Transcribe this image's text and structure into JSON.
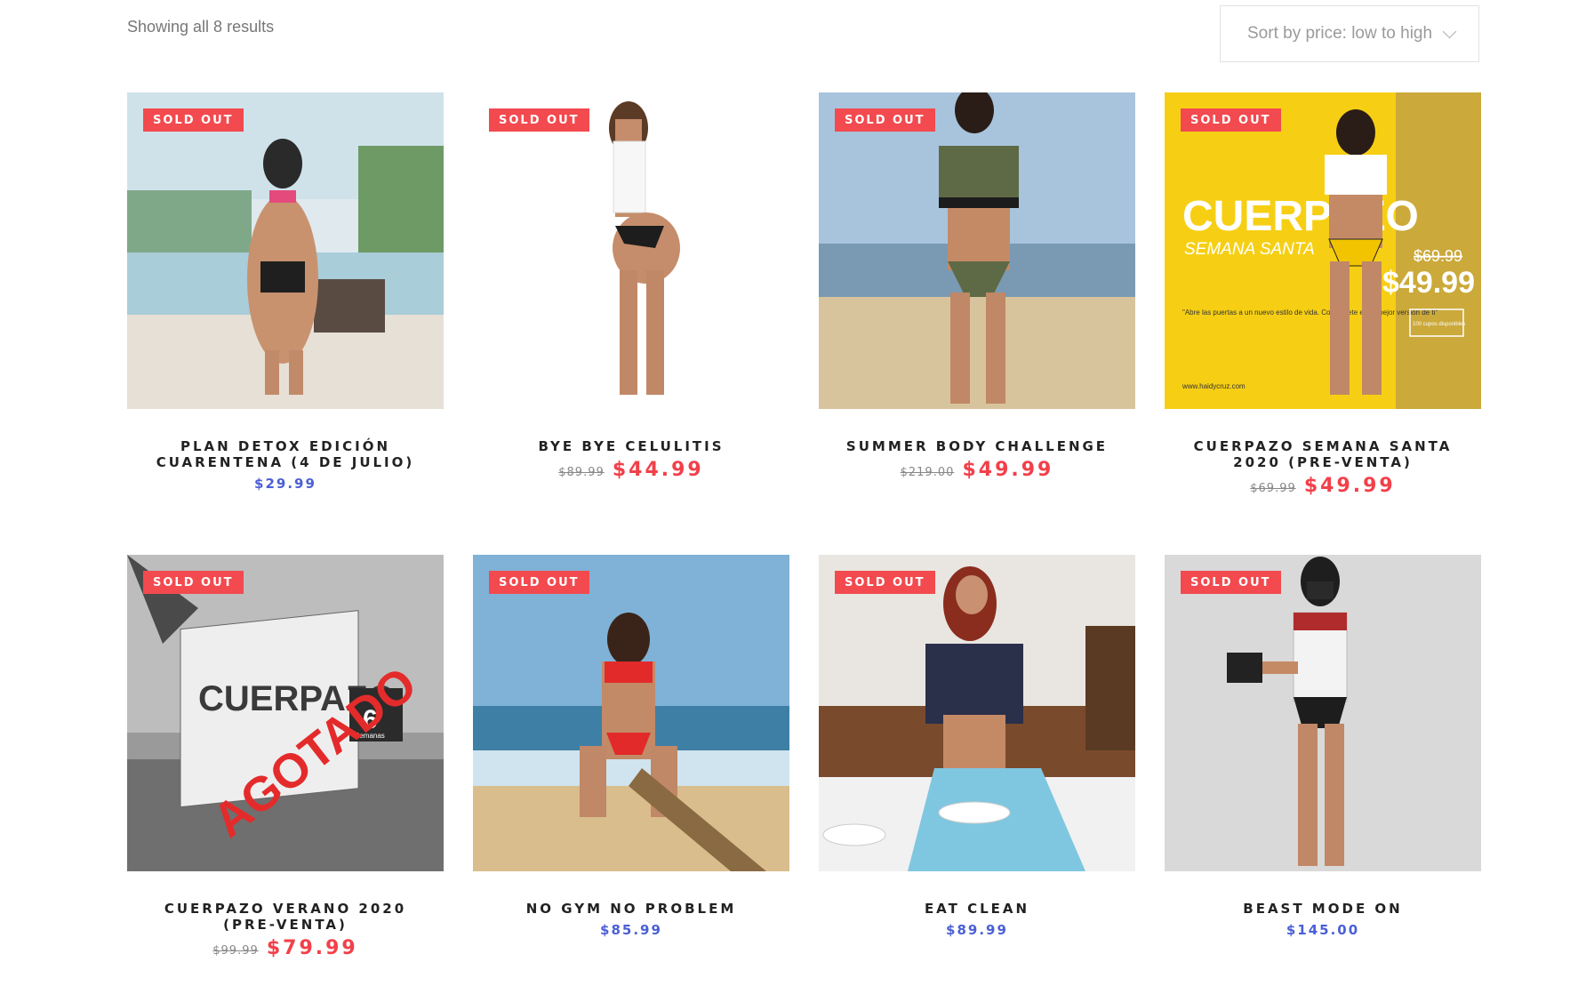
{
  "toolbar": {
    "result_count": "Showing all 8 results",
    "sort_label": "Sort by price: low to high"
  },
  "products": [
    {
      "title": "PLAN DETOX EDICIÓN CUARENTENA (4 DE JULIO)",
      "badge": "SOLD OUT",
      "price": "$29.99",
      "old_price": "",
      "sale_price": ""
    },
    {
      "title": "BYE BYE CELULITIS",
      "badge": "SOLD OUT",
      "price": "",
      "old_price": "$89.99",
      "sale_price": "$44.99"
    },
    {
      "title": "SUMMER BODY CHALLENGE",
      "badge": "SOLD OUT",
      "price": "",
      "old_price": "$219.00",
      "sale_price": "$49.99"
    },
    {
      "title": "CUERPAZO SEMANA SANTA 2020 (PRE-VENTA)",
      "badge": "SOLD OUT",
      "price": "",
      "old_price": "$69.99",
      "sale_price": "$49.99"
    },
    {
      "title": "CUERPAZO VERANO 2020 (PRE-VENTA)",
      "badge": "SOLD OUT",
      "price": "",
      "old_price": "$99.99",
      "sale_price": "$79.99"
    },
    {
      "title": "NO GYM NO PROBLEM",
      "badge": "SOLD OUT",
      "price": "$85.99",
      "old_price": "",
      "sale_price": ""
    },
    {
      "title": "EAT CLEAN",
      "badge": "SOLD OUT",
      "price": "$89.99",
      "old_price": "",
      "sale_price": ""
    },
    {
      "title": "BEAST MODE ON",
      "badge": "SOLD OUT",
      "price": "$145.00",
      "old_price": "",
      "sale_price": ""
    }
  ],
  "poster_text": {
    "semana_headline": "CUERPAZO",
    "semana_sub": "SEMANA SANTA",
    "semana_old": "$69.99",
    "semana_new": "$49.99",
    "semana_quote": "\"Abre las puertas a un nuevo estilo de vida. Conviértete en la mejor versión de ti\"",
    "semana_cupos": "100 cupos disponibles",
    "semana_url": "www.haidycruz.com",
    "verano_box": "CUERPAZO",
    "verano_stamp": "AGOTADO",
    "verano_weeks": "6",
    "verano_weeks_label": "Semanas"
  },
  "colors": {
    "badge": "#f24a4f",
    "sale": "#f2404a",
    "regular_price": "#4a5fd6"
  }
}
